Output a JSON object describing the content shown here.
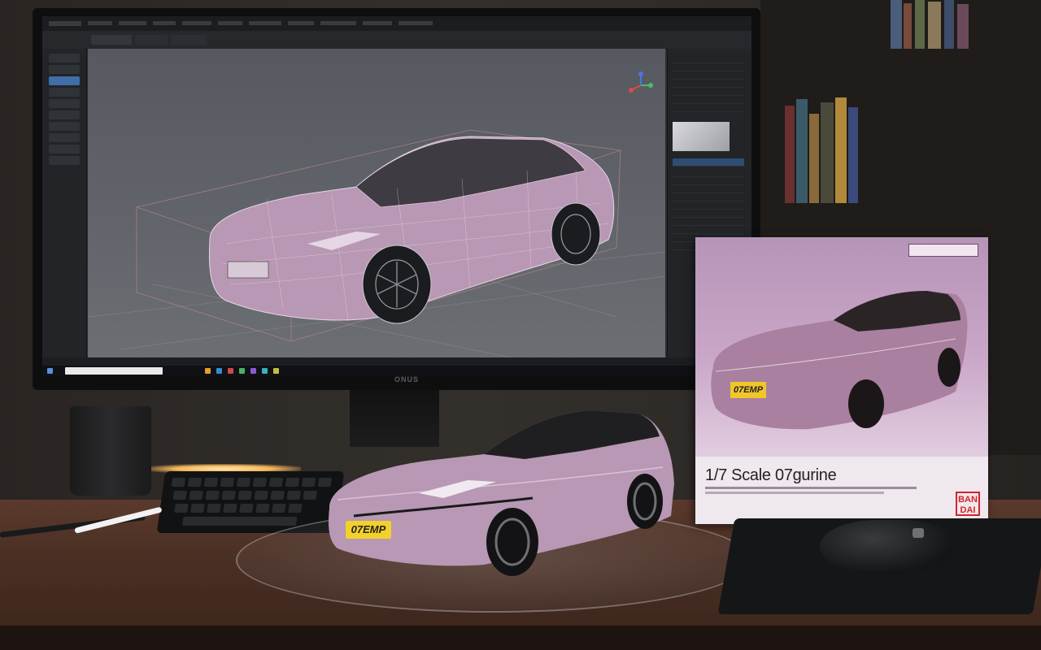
{
  "viewport": {
    "width": 1280,
    "height": 800
  },
  "scene": "Desk with monitor showing 3D car model, physical car figure on turntable, and boxed figure",
  "box": {
    "title": "1/7 Scale 07gurine",
    "plate": "07EMP",
    "brand_logo": "BAN DAI"
  },
  "model": {
    "plate": "07EMP",
    "color": "#b898b4"
  },
  "monitor": {
    "brand": "ONUS"
  },
  "colors": {
    "car_body": "#b898b4",
    "car_roof": "#1f1f22",
    "plate": "#f4d02a",
    "viewport_bg": "#5e6167",
    "ui_accent": "#3f6ea8"
  }
}
